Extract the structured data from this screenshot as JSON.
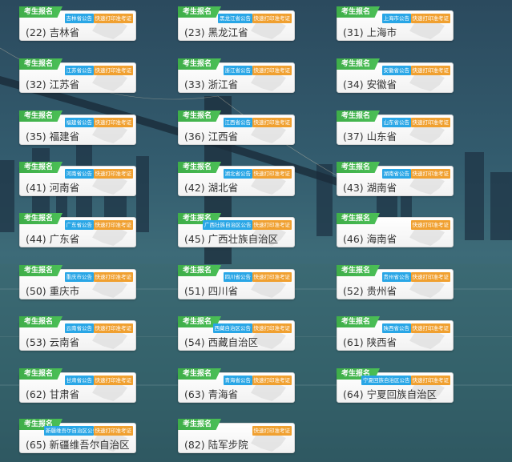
{
  "common": {
    "kaosheng_label": "考生报名",
    "print_label": "快速打印准考证"
  },
  "colors": {
    "notice": "#29a6e6",
    "print": "#f0a030",
    "kaosheng": "#3fae49"
  },
  "provinces": [
    {
      "label": "(22) 吉林省",
      "notice": "吉林省公告"
    },
    {
      "label": "(23) 黑龙江省",
      "notice": "黑龙江省公告"
    },
    {
      "label": "(31) 上海市",
      "notice": "上海市公告"
    },
    {
      "label": "(32) 江苏省",
      "notice": "江苏省公告"
    },
    {
      "label": "(33) 浙江省",
      "notice": "浙江省公告"
    },
    {
      "label": "(34) 安徽省",
      "notice": "安徽省公告"
    },
    {
      "label": "(35) 福建省",
      "notice": "福建省公告"
    },
    {
      "label": "(36) 江西省",
      "notice": "江西省公告"
    },
    {
      "label": "(37) 山东省",
      "notice": "山东省公告"
    },
    {
      "label": "(41) 河南省",
      "notice": "河南省公告"
    },
    {
      "label": "(42) 湖北省",
      "notice": "湖北省公告"
    },
    {
      "label": "(43) 湖南省",
      "notice": "湖南省公告"
    },
    {
      "label": "(44) 广东省",
      "notice": "广东省公告"
    },
    {
      "label": "(45) 广西壮族自治区",
      "notice": "广西壮族自治区公告"
    },
    {
      "label": "(46) 海南省",
      "notice": ""
    },
    {
      "label": "(50) 重庆市",
      "notice": "重庆市公告"
    },
    {
      "label": "(51) 四川省",
      "notice": "四川省公告"
    },
    {
      "label": "(52) 贵州省",
      "notice": "贵州省公告"
    },
    {
      "label": "(53) 云南省",
      "notice": "云南省公告"
    },
    {
      "label": "(54) 西藏自治区",
      "notice": "西藏自治区公告"
    },
    {
      "label": "(61) 陕西省",
      "notice": "陕西省公告"
    },
    {
      "label": "(62) 甘肃省",
      "notice": "甘肃省公告"
    },
    {
      "label": "(63) 青海省",
      "notice": "青海省公告"
    },
    {
      "label": "(64) 宁夏回族自治区",
      "notice": "宁夏回族自治区公告"
    },
    {
      "label": "(65) 新疆维吾尔自治区",
      "notice": "新疆维吾尔自治区公告"
    },
    {
      "label": "(82) 陆军步院",
      "notice": ""
    }
  ]
}
